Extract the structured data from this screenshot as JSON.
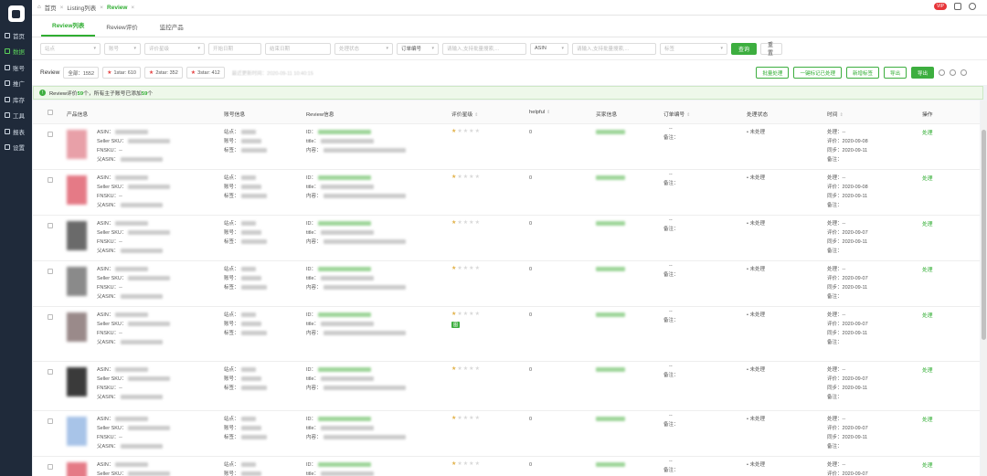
{
  "sidebar": {
    "items": [
      {
        "label": "首页",
        "active": false
      },
      {
        "label": "数据",
        "active": true
      },
      {
        "label": "账号",
        "active": false
      },
      {
        "label": "推广",
        "active": false
      },
      {
        "label": "库存",
        "active": false
      },
      {
        "label": "工具",
        "active": false
      },
      {
        "label": "报表",
        "active": false
      },
      {
        "label": "设置",
        "active": false
      }
    ]
  },
  "topbar": {
    "crumbs": [
      "首页",
      "Listing列表",
      "Review"
    ],
    "badge": "VIP"
  },
  "tabs": [
    "Review列表",
    "Review评价",
    "监控产品"
  ],
  "filters": {
    "f1": "站点",
    "f2": "账号",
    "f3": "评价星级",
    "f4": "开始日期",
    "f5": "结束日期",
    "f6": "处理状态",
    "f7": "订单编号",
    "f7_input": "请输入,支持批量搜索,...",
    "f8": "ASIN",
    "f8_input": "请输入,支持批量搜索,...",
    "f9": "标签",
    "search": "查询",
    "reset": "重置"
  },
  "summary": {
    "label": "Review",
    "all": "全部：1552",
    "s1": "1star: 610",
    "s2": "2star: 352",
    "s3": "3star: 412",
    "note": "最近更新时间：2020-09-11 10:40:15",
    "actions": [
      "批量处理",
      "一键标记已处理",
      "新增标签",
      "导出"
    ],
    "export": "导出"
  },
  "notice": {
    "prefix": "Review评价",
    "count1": "59",
    "mid": "个，所有主子账号已添加",
    "count2": "59",
    "suffix": "个"
  },
  "table": {
    "headers": [
      "产品信息",
      "账号信息",
      "Review信息",
      "评价星级",
      "helpful",
      "买家信息",
      "订单编号",
      "处理状态",
      "时间",
      "操作"
    ],
    "product_labels": [
      "ASIN：",
      "Seller SKU：",
      "FNSKU：",
      "父ASIN："
    ],
    "product_fnsku_value": "--",
    "account_labels": [
      "站点：",
      "账号：",
      "标签："
    ],
    "review_labels": [
      "ID：",
      "title：",
      "内容："
    ],
    "order_value": "--",
    "remark_label": "备注：",
    "time_labels": [
      "处理：",
      "评价：",
      "同步：",
      "备注："
    ],
    "rows": [
      {
        "stars": 1,
        "helpful": "0",
        "status": "• 未处理",
        "t1": "--",
        "t2": "2020-09-08",
        "t3": "2020-09-11",
        "op": "处理",
        "thumb": "#e8a0a8",
        "tag": ""
      },
      {
        "stars": 1,
        "helpful": "0",
        "status": "• 未处理",
        "t1": "--",
        "t2": "2020-09-08",
        "t3": "2020-09-11",
        "op": "处理",
        "thumb": "#e57a86",
        "tag": ""
      },
      {
        "stars": 1,
        "helpful": "0",
        "status": "• 未处理",
        "t1": "--",
        "t2": "2020-09-07",
        "t3": "2020-09-11",
        "op": "处理",
        "thumb": "#6a6a6a",
        "tag": ""
      },
      {
        "stars": 1,
        "helpful": "0",
        "status": "• 未处理",
        "t1": "--",
        "t2": "2020-09-07",
        "t3": "2020-09-11",
        "op": "处理",
        "thumb": "#8a8a8a",
        "tag": ""
      },
      {
        "stars": 1,
        "helpful": "0",
        "status": "• 未处理",
        "t1": "--",
        "t2": "2020-09-07",
        "t3": "2020-09-11",
        "op": "处理",
        "thumb": "#9a8a8a",
        "tag": "图"
      },
      {
        "stars": 1,
        "helpful": "0",
        "status": "• 未处理",
        "t1": "--",
        "t2": "2020-09-07",
        "t3": "2020-09-11",
        "op": "处理",
        "thumb": "#3a3a3a",
        "tag": ""
      },
      {
        "stars": 1,
        "helpful": "0",
        "status": "• 未处理",
        "t1": "--",
        "t2": "2020-09-07",
        "t3": "2020-09-11",
        "op": "处理",
        "thumb": "#a8c4e8",
        "tag": ""
      },
      {
        "stars": 1,
        "helpful": "0",
        "status": "• 未处理",
        "t1": "--",
        "t2": "2020-09-07",
        "t3": "2020-09-11",
        "op": "处理",
        "thumb": "#e57a86",
        "tag": ""
      }
    ]
  }
}
